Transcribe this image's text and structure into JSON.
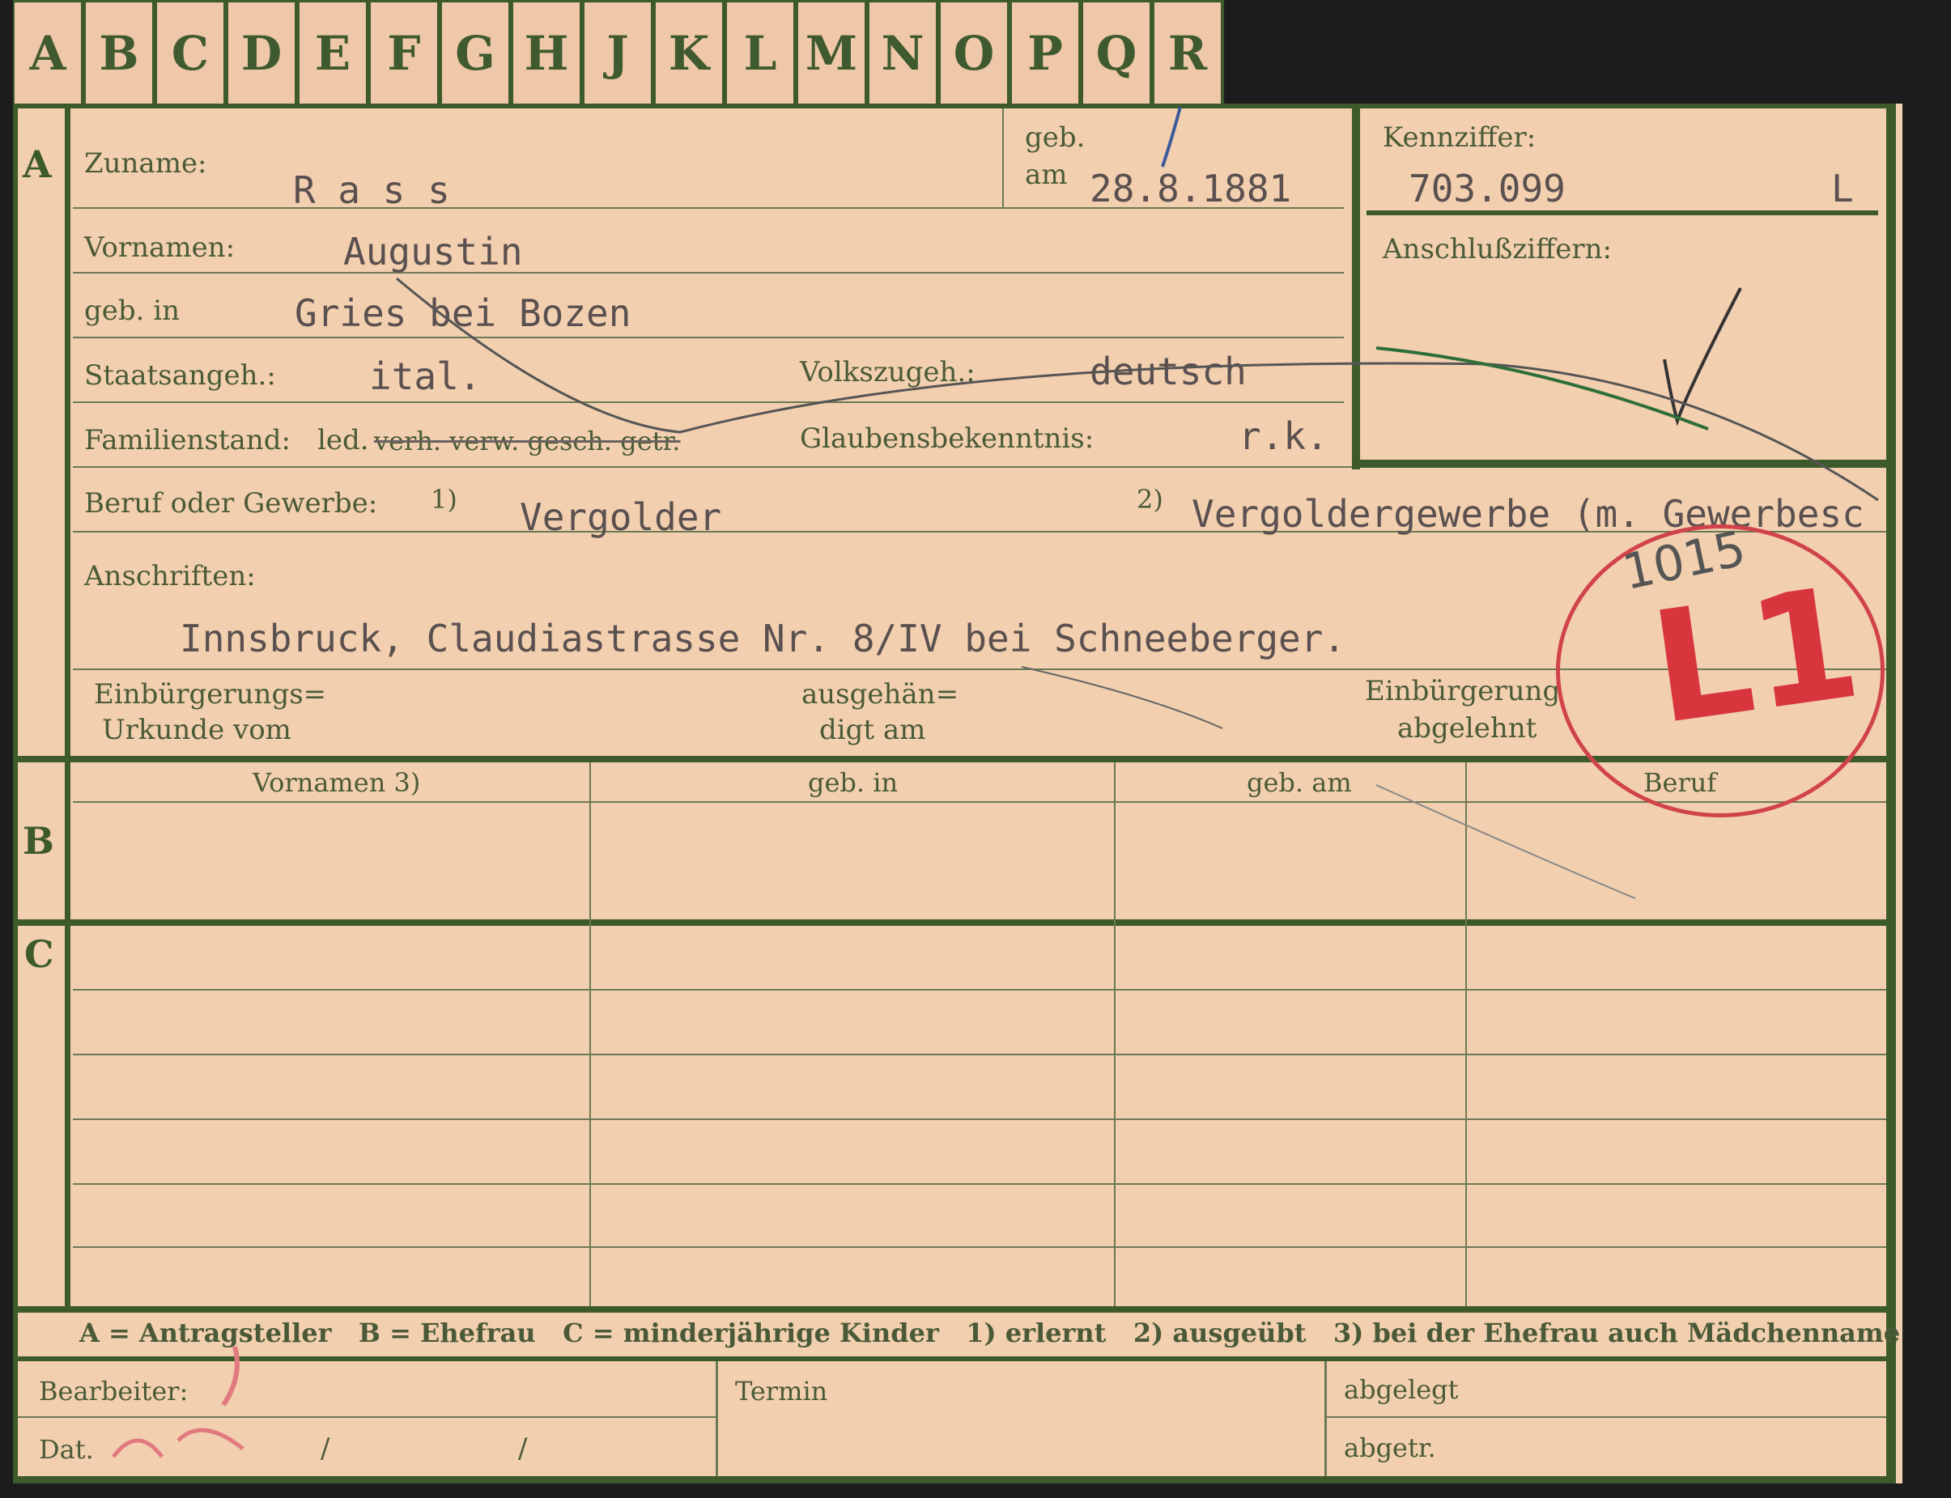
{
  "tabs": [
    "A",
    "B",
    "C",
    "D",
    "E",
    "F",
    "G",
    "H",
    "J",
    "K",
    "L",
    "M",
    "N",
    "O",
    "P",
    "Q",
    "R"
  ],
  "section_letters": {
    "a": "A",
    "b": "B",
    "c": "C"
  },
  "fields": {
    "zuname_label": "Zuname:",
    "zuname_value": "R a s s",
    "geb_label": "geb.",
    "am_label": "am",
    "geb_am_value": "28.8.1881",
    "kennziffer_label": "Kennziffer:",
    "kennziffer_value": "703.099",
    "kennziffer_suffix": "L",
    "anschluss_label": "Anschlußziffern:",
    "vornamen_label": "Vornamen:",
    "vornamen_value": "Augustin",
    "geb_in_label": "geb. in",
    "geb_in_value": "Gries bei Bozen",
    "staats_label": "Staatsangeh.:",
    "staats_value": "ital.",
    "volks_label": "Volkszugeh.:",
    "volks_value": "deutsch",
    "familien_label": "Familienstand:",
    "familien_value": "led.",
    "familien_struck": "verh. verw. gesch. getr.",
    "glaubens_label": "Glaubensbekenntnis:",
    "glaubens_value": "r.k.",
    "beruf_label": "Beruf oder Gewerbe:",
    "beruf_1_mark": "1)",
    "beruf_1_value": "Vergolder",
    "beruf_2_mark": "2)",
    "beruf_2_value": "Vergoldergewerbe (m. Gewerbesc",
    "anschriften_label": "Anschriften:",
    "anschriften_value": "Innsbruck, Claudiastrasse Nr. 8/IV bei Schneeberger.",
    "einb_urkunde_1": "Einbürgerungs=",
    "einb_urkunde_2": "Urkunde vom",
    "ausgeh_1": "ausgehän=",
    "ausgeh_2": "digt am",
    "einb_abg_1": "Einbürgerung",
    "einb_abg_2": "abgelehnt"
  },
  "table_headers": [
    "Vornamen 3)",
    "geb. in",
    "geb. am",
    "Beruf"
  ],
  "legend": "A = Antragsteller   B = Ehefrau   C = minderjährige Kinder   1) erlernt   2) ausgeübt   3) bei der Ehefrau auch Mädchenname",
  "footer": {
    "bearbeiter_label": "Bearbeiter:",
    "dat_label": "Dat.",
    "dat_slash1": "/",
    "dat_slash2": "/",
    "termin_label": "Termin",
    "abgelegt_label": "abgelegt",
    "abgetr_label": "abgetr."
  },
  "stamp": {
    "text": "L1",
    "number": "1015"
  },
  "colors": {
    "card": "#f2cfae",
    "ink_green": "#3d5a2a",
    "stamp_red": "#d8353d"
  }
}
